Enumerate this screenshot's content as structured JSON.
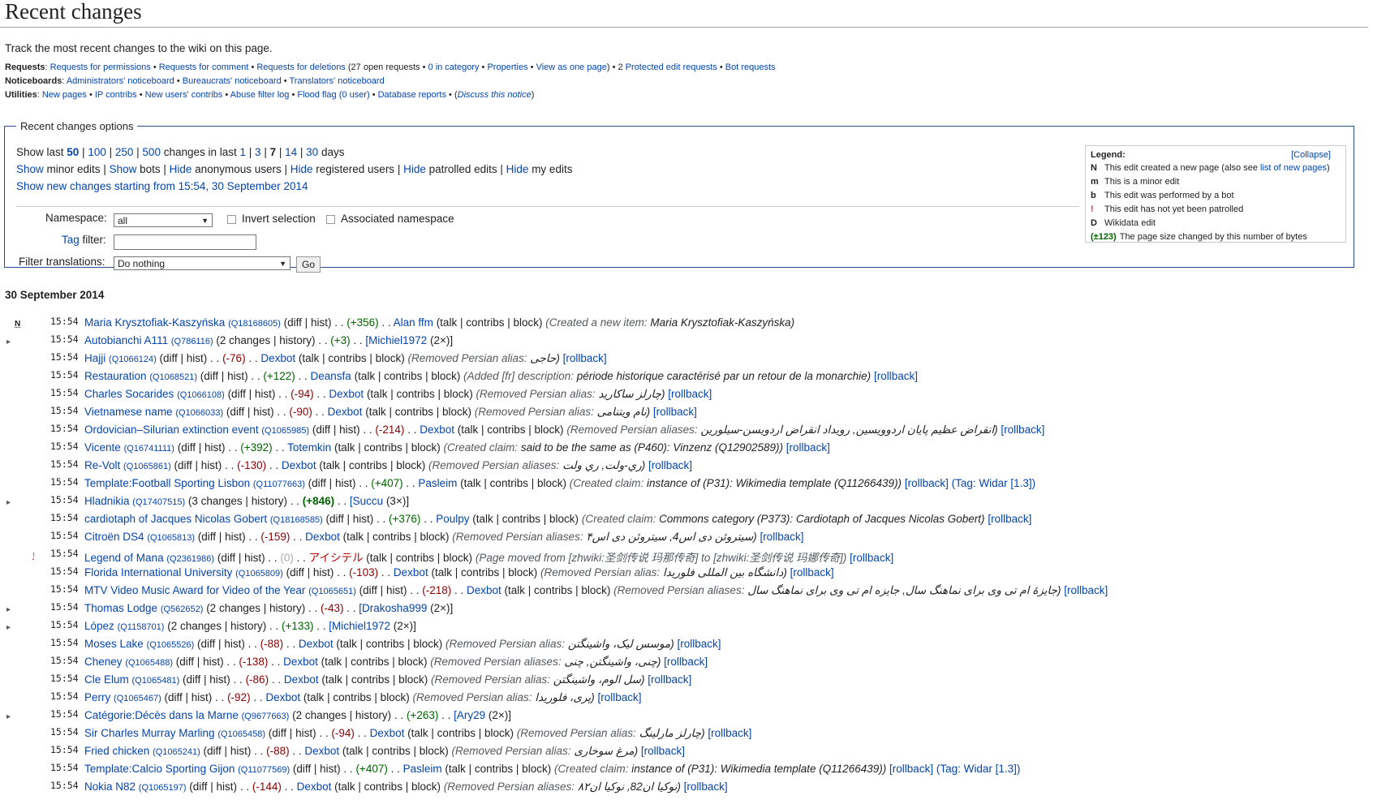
{
  "title": "Recent changes",
  "intro": "Track the most recent changes to the wiki on this page.",
  "requests": {
    "label": "Requests",
    "links": [
      "Requests for permissions",
      "Requests for comment",
      "Requests for deletions",
      "0 in category",
      "Properties",
      "View as one page",
      "Protected edit requests",
      "Bot requests"
    ],
    "open_count": "(27 open requests • ",
    "close": ") • 2 "
  },
  "noticeboards": {
    "label": "Noticeboards",
    "links": [
      "Administrators' noticeboard",
      "Bureaucrats' noticeboard",
      "Translators' noticeboard"
    ]
  },
  "utilities": {
    "label": "Utilities",
    "links": [
      "New pages",
      "IP contribs",
      "New users' contribs",
      "Abuse filter log",
      "Flood flag",
      "(0 user)",
      "Database reports",
      "Discuss this notice"
    ]
  },
  "options": {
    "legend": "Recent changes options",
    "line1": {
      "pre": "Show last ",
      "counts": [
        "50",
        "100",
        "250",
        "500"
      ],
      "mid": " changes in last ",
      "days": [
        "1",
        "3",
        "7",
        "14",
        "30"
      ],
      "post": " days"
    },
    "line2": {
      "items": [
        {
          "link": "Show",
          "text": " minor edits"
        },
        {
          "link": "Show",
          "text": " bots"
        },
        {
          "link": "Hide",
          "text": " anonymous users"
        },
        {
          "link": "Hide",
          "text": " registered users"
        },
        {
          "link": "Hide",
          "text": " patrolled edits"
        },
        {
          "link": "Hide",
          "text": " my edits"
        }
      ]
    },
    "line3": "Show new changes starting from 15:54, 30 September 2014",
    "namespace_label": "Namespace:",
    "namespace_value": "all",
    "invert_label": "Invert selection",
    "associated_label": "Associated namespace",
    "tag_link": "Tag",
    "tag_label": " filter:",
    "filter_label": "Filter translations:",
    "filter_value": "Do nothing",
    "go_label": "Go"
  },
  "legend": {
    "title": "Legend:",
    "collapse": "[Collapse]",
    "items": [
      {
        "key": "N",
        "text": "This edit created a new page (also see ",
        "link": "list of new pages",
        "after": ")"
      },
      {
        "key": "m",
        "text": "This is a minor edit"
      },
      {
        "key": "b",
        "text": "This edit was performed by a bot"
      },
      {
        "key": "!",
        "text": "This edit has not yet been patrolled"
      },
      {
        "key": "D",
        "text": "Wikidata edit"
      },
      {
        "key": "(±123)",
        "text": "The page size changed by this number of bytes"
      }
    ],
    "colors": {
      "pos": "#006400",
      "neg": "#8b0000",
      "unpatrolled": "#d33"
    }
  },
  "day_heading": "30 September 2014",
  "changes": [
    {
      "flag": "N",
      "time": "15:54",
      "page": "Maria Krysztofiak-Kaszyńska",
      "qid": "(Q18168605)",
      "links": "(diff | hist)",
      "size": "(+356)",
      "sign": "pos",
      "user": "Alan ffm",
      "tools": "(talk | contribs | block)",
      "comment": "(Created a new item: ",
      "ctext": "Maria Krysztofiak-Kaszyńska)",
      "rb": ""
    },
    {
      "flag": "▸",
      "time": "15:54",
      "page": "Autobianchi A111",
      "qid": "(Q786116)",
      "links": "(2 changes | history)",
      "size": "(+3)",
      "sign": "pos",
      "user": "[Michiel1972",
      "tools": "(2×)]",
      "comment": "",
      "ctext": "",
      "rb": ""
    },
    {
      "flag": "",
      "time": "15:54",
      "page": "Hajji",
      "qid": "(Q1066124)",
      "links": "(diff | hist)",
      "size": "(-76)",
      "sign": "neg",
      "user": "Dexbot",
      "tools": "(talk | contribs | block)",
      "comment": "(Removed Persian alias: ",
      "ctext": "حاجی)",
      "rb": "[rollback]"
    },
    {
      "flag": "",
      "time": "15:54",
      "page": "Restauration",
      "qid": "(Q1068521)",
      "links": "(diff | hist)",
      "size": "(+122)",
      "sign": "pos",
      "user": "Deansfa",
      "tools": "(talk | contribs | block)",
      "comment": "(Added [fr] description: ",
      "ctext": "période historique caractérisé par un retour de la monarchie)",
      "rb": "[rollback]"
    },
    {
      "flag": "",
      "time": "15:54",
      "page": "Charles Socarides",
      "qid": "(Q1066108)",
      "links": "(diff | hist)",
      "size": "(-94)",
      "sign": "neg",
      "user": "Dexbot",
      "tools": "(talk | contribs | block)",
      "comment": "(Removed Persian alias: ",
      "ctext": "چارلز ساکارید)",
      "rb": "[rollback]"
    },
    {
      "flag": "",
      "time": "15:54",
      "page": "Vietnamese name",
      "qid": "(Q1066033)",
      "links": "(diff | hist)",
      "size": "(-90)",
      "sign": "neg",
      "user": "Dexbot",
      "tools": "(talk | contribs | block)",
      "comment": "(Removed Persian alias: ",
      "ctext": "نام ویتنامی)",
      "rb": "[rollback]"
    },
    {
      "flag": "",
      "time": "15:54",
      "page": "Ordovician–Silurian extinction event",
      "qid": "(Q1065985)",
      "links": "(diff | hist)",
      "size": "(-214)",
      "sign": "neg",
      "user": "Dexbot",
      "tools": "(talk | contribs | block)",
      "comment": "(Removed Persian aliases: ",
      "ctext": "انقراض عظیم پایان اردوویسین, رویداد انقراض اردویسن-سیلورین)",
      "rb": "[rollback]"
    },
    {
      "flag": "",
      "time": "15:54",
      "page": "Vicente",
      "qid": "(Q16741111)",
      "links": "(diff | hist)",
      "size": "(+392)",
      "sign": "pos",
      "user": "Totemkin",
      "tools": "(talk | contribs | block)",
      "comment": "(Created claim: ",
      "ctext": "said to be the same as (P460): Vinzenz (Q12902589))",
      "rb": "[rollback]"
    },
    {
      "flag": "",
      "time": "15:54",
      "page": "Re-Volt",
      "qid": "(Q1065861)",
      "links": "(diff | hist)",
      "size": "(-130)",
      "sign": "neg",
      "user": "Dexbot",
      "tools": "(talk | contribs | block)",
      "comment": "(Removed Persian aliases: ",
      "ctext": "ري-ولت, ري ولت)",
      "rb": "[rollback]"
    },
    {
      "flag": "",
      "time": "15:54",
      "page": "Template:Football Sporting Lisbon",
      "qid": "(Q11077663)",
      "links": "(diff | hist)",
      "size": "(+407)",
      "sign": "pos",
      "user": "Pasleim",
      "tools": "(talk | contribs | block)",
      "comment": "(Created claim: ",
      "ctext": "instance of (P31): Wikimedia template (Q11266439))",
      "rb": "[rollback] (Tag: Widar [1.3])"
    },
    {
      "flag": "▸",
      "time": "15:54",
      "page": "Hladnikia",
      "qid": "(Q17407515)",
      "links": "(3 changes | history)",
      "size": "(+846)",
      "sign": "pos",
      "user": "[Succu",
      "tools": "(3×)]",
      "comment": "",
      "ctext": "",
      "rb": ""
    },
    {
      "flag": "",
      "time": "15:54",
      "page": "cardiotaph of Jacques Nicolas Gobert",
      "qid": "(Q18168585)",
      "links": "(diff | hist)",
      "size": "(+376)",
      "sign": "pos",
      "user": "Poulpy",
      "tools": "(talk | contribs | block)",
      "comment": "(Created claim: ",
      "ctext": "Commons category (P373): Cardiotaph of Jacques Nicolas Gobert)",
      "rb": "[rollback]"
    },
    {
      "flag": "",
      "time": "15:54",
      "page": "Citroën DS4",
      "qid": "(Q1065813)",
      "links": "(diff | hist)",
      "size": "(-159)",
      "sign": "neg",
      "user": "Dexbot",
      "tools": "(talk | contribs | block)",
      "comment": "(Removed Persian aliases: ",
      "ctext": "سیتروئن دی اس4, سیتروئن دی اس۴)",
      "rb": "[rollback]"
    },
    {
      "flag": "!",
      "time": "15:54",
      "page": "Legend of Mana",
      "qid": "(Q2361986)",
      "links": "(diff | hist)",
      "size": "(0)",
      "sign": "neu",
      "user": "アイシテル",
      "tools": "(talk | contribs | block)",
      "comment": "(Page moved from [zhwiki:圣剑传说 玛那传奇] to [zhwiki:圣剑传说 玛娜传奇])",
      "ctext": "",
      "rb": "[rollback]"
    },
    {
      "flag": "",
      "time": "15:54",
      "page": "Florida International University",
      "qid": "(Q1065809)",
      "links": "(diff | hist)",
      "size": "(-103)",
      "sign": "neg",
      "user": "Dexbot",
      "tools": "(talk | contribs | block)",
      "comment": "(Removed Persian alias: ",
      "ctext": "دانشگاه بین المللی فلوریدا)",
      "rb": "[rollback]"
    },
    {
      "flag": "",
      "time": "15:54",
      "page": "MTV Video Music Award for Video of the Year",
      "qid": "(Q1065651)",
      "links": "(diff | hist)",
      "size": "(-218)",
      "sign": "neg",
      "user": "Dexbot",
      "tools": "(talk | contribs | block)",
      "comment": "(Removed Persian aliases: ",
      "ctext": "جایزهٔ ام تی وی برای نماهنگ سال, جایزه ام تی وی برای نماهنگ سال)",
      "rb": "[rollback]"
    },
    {
      "flag": "▸",
      "time": "15:54",
      "page": "Thomas Lodge",
      "qid": "(Q562652)",
      "links": "(2 changes | history)",
      "size": "(-43)",
      "sign": "neg",
      "user": "[Drakosha999",
      "tools": "(2×)]",
      "comment": "",
      "ctext": "",
      "rb": ""
    },
    {
      "flag": "▸",
      "time": "15:54",
      "page": "López",
      "qid": "(Q1158701)",
      "links": "(2 changes | history)",
      "size": "(+133)",
      "sign": "pos",
      "user": "[Michiel1972",
      "tools": "(2×)]",
      "comment": "",
      "ctext": "",
      "rb": ""
    },
    {
      "flag": "",
      "time": "15:54",
      "page": "Moses Lake",
      "qid": "(Q1065526)",
      "links": "(diff | hist)",
      "size": "(-88)",
      "sign": "neg",
      "user": "Dexbot",
      "tools": "(talk | contribs | block)",
      "comment": "(Removed Persian alias: ",
      "ctext": "موسس لیک، واشینگتن)",
      "rb": "[rollback]"
    },
    {
      "flag": "",
      "time": "15:54",
      "page": "Cheney",
      "qid": "(Q1065488)",
      "links": "(diff | hist)",
      "size": "(-138)",
      "sign": "neg",
      "user": "Dexbot",
      "tools": "(talk | contribs | block)",
      "comment": "(Removed Persian aliases: ",
      "ctext": "چنی، واشینگتن, چنی)",
      "rb": "[rollback]"
    },
    {
      "flag": "",
      "time": "15:54",
      "page": "Cle Elum",
      "qid": "(Q1065481)",
      "links": "(diff | hist)",
      "size": "(-86)",
      "sign": "neg",
      "user": "Dexbot",
      "tools": "(talk | contribs | block)",
      "comment": "(Removed Persian alias: ",
      "ctext": "سل الوم، واشینگتن)",
      "rb": "[rollback]"
    },
    {
      "flag": "",
      "time": "15:54",
      "page": "Perry",
      "qid": "(Q1065467)",
      "links": "(diff | hist)",
      "size": "(-92)",
      "sign": "neg",
      "user": "Dexbot",
      "tools": "(talk | contribs | block)",
      "comment": "(Removed Persian alias: ",
      "ctext": "پری، فلوریدا)",
      "rb": "[rollback]"
    },
    {
      "flag": "▸",
      "time": "15:54",
      "page": "Catégorie:Décès dans la Marne",
      "qid": "(Q9677663)",
      "links": "(2 changes | history)",
      "size": "(+263)",
      "sign": "pos",
      "user": "[Ary29",
      "tools": "(2×)]",
      "comment": "",
      "ctext": "",
      "rb": ""
    },
    {
      "flag": "",
      "time": "15:54",
      "page": "Sir Charles Murray Marling",
      "qid": "(Q1065458)",
      "links": "(diff | hist)",
      "size": "(-94)",
      "sign": "neg",
      "user": "Dexbot",
      "tools": "(talk | contribs | block)",
      "comment": "(Removed Persian alias: ",
      "ctext": "چارلز مارلینگ)",
      "rb": "[rollback]"
    },
    {
      "flag": "",
      "time": "15:54",
      "page": "Fried chicken",
      "qid": "(Q1065241)",
      "links": "(diff | hist)",
      "size": "(-88)",
      "sign": "neg",
      "user": "Dexbot",
      "tools": "(talk | contribs | block)",
      "comment": "(Removed Persian alias: ",
      "ctext": "مرغ سوخاری)",
      "rb": "[rollback]"
    },
    {
      "flag": "",
      "time": "15:54",
      "page": "Template:Calcio Sporting Gijon",
      "qid": "(Q11077569)",
      "links": "(diff | hist)",
      "size": "(+407)",
      "sign": "pos",
      "user": "Pasleim",
      "tools": "(talk | contribs | block)",
      "comment": "(Created claim: ",
      "ctext": "instance of (P31): Wikimedia template (Q11266439))",
      "rb": "[rollback] (Tag: Widar [1.3])"
    },
    {
      "flag": "",
      "time": "15:54",
      "page": "Nokia N82",
      "qid": "(Q1065197)",
      "links": "(diff | hist)",
      "size": "(-144)",
      "sign": "neg",
      "user": "Dexbot",
      "tools": "(talk | contribs | block)",
      "comment": "(Removed Persian aliases: ",
      "ctext": "نوکیا ان82, نوکیا ان۸۲)",
      "rb": "[rollback]"
    }
  ]
}
